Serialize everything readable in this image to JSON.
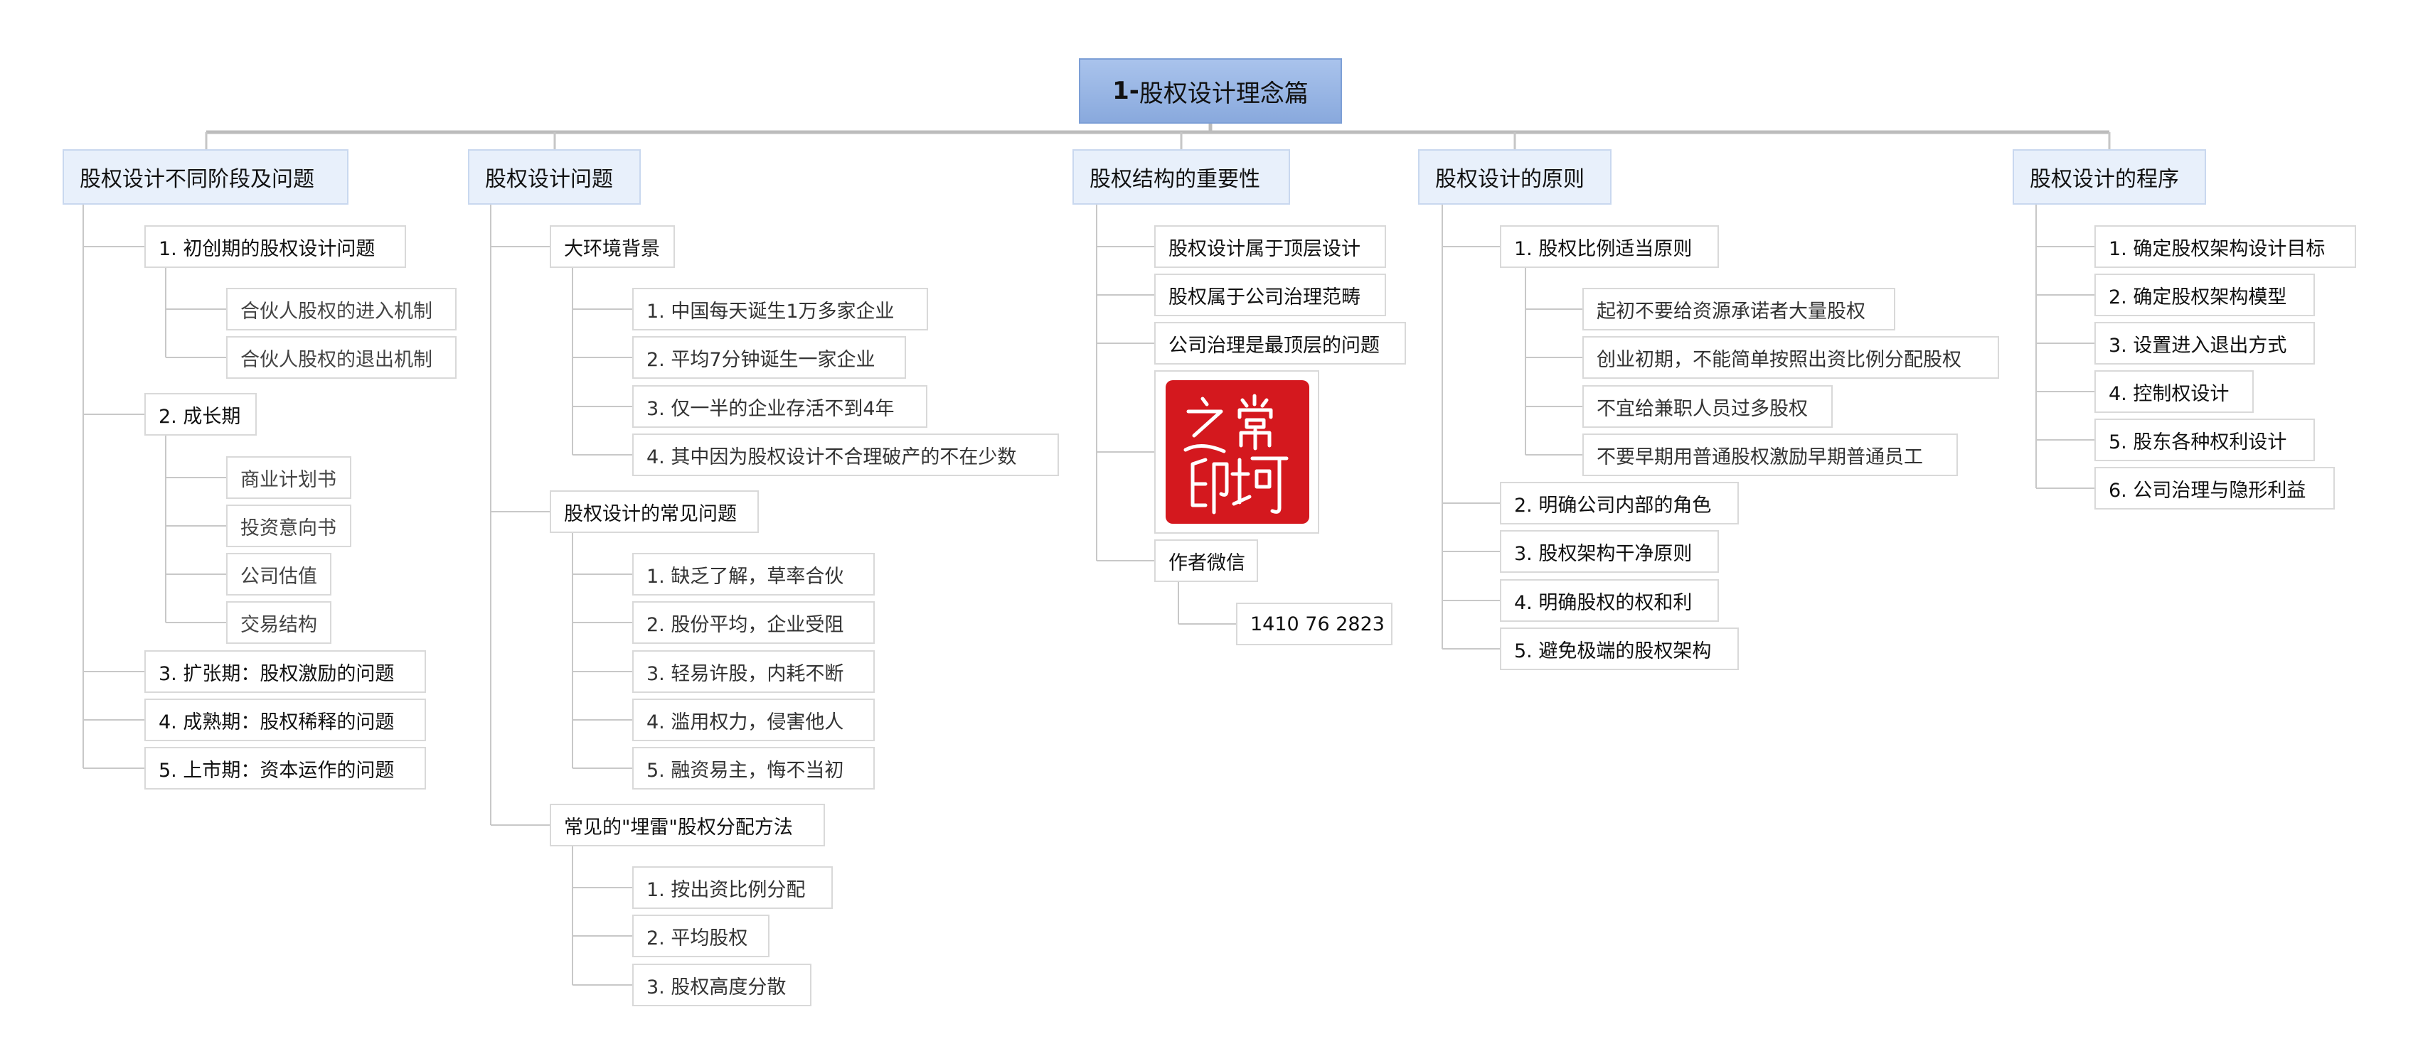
{
  "root": {
    "prefix": "1-",
    "title": "股权设计理念篇"
  },
  "branches": [
    {
      "title": "股权设计不同阶段及问题",
      "items": [
        {
          "label": "1. 初创期的股权设计问题",
          "children": [
            "合伙人股权的进入机制",
            "合伙人股权的退出机制"
          ]
        },
        {
          "label": "2. 成长期",
          "children": [
            "商业计划书",
            "投资意向书",
            "公司估值",
            "交易结构"
          ]
        },
        {
          "label": "3. 扩张期：股权激励的问题"
        },
        {
          "label": "4. 成熟期：股权稀释的问题"
        },
        {
          "label": "5. 上市期：资本运作的问题"
        }
      ]
    },
    {
      "title": "股权设计问题",
      "items": [
        {
          "label": "大环境背景",
          "children": [
            "1. 中国每天诞生1万多家企业",
            "2. 平均7分钟诞生一家企业",
            "3. 仅一半的企业存活不到4年",
            "4. 其中因为股权设计不合理破产的不在少数"
          ]
        },
        {
          "label": "股权设计的常见问题",
          "children": [
            "1. 缺乏了解，草率合伙",
            "2. 股份平均，企业受阻",
            "3. 轻易许股，内耗不断",
            "4. 滥用权力，侵害他人",
            "5. 融资易主，悔不当初"
          ]
        },
        {
          "label": "常见的\"埋雷\"股权分配方法",
          "children": [
            "1. 按出资比例分配",
            "2. 平均股权",
            "3. 股权高度分散"
          ]
        }
      ]
    },
    {
      "title": "股权结构的重要性",
      "items": [
        {
          "label": "股权设计属于顶层设计"
        },
        {
          "label": "股权属于公司治理范畴"
        },
        {
          "label": "公司治理是最顶层的问题"
        },
        {
          "label": "作者微信",
          "children": [
            "1410 76 2823"
          ]
        }
      ],
      "seal": {
        "text": "常坷之印",
        "color": "#d4181e"
      }
    },
    {
      "title": "股权设计的原则",
      "items": [
        {
          "label": "1. 股权比例适当原则",
          "children": [
            "起初不要给资源承诺者大量股权",
            "创业初期，不能简单按照出资比例分配股权",
            "不宜给兼职人员过多股权",
            "不要早期用普通股权激励早期普通员工"
          ]
        },
        {
          "label": "2. 明确公司内部的角色"
        },
        {
          "label": "3. 股权架构干净原则"
        },
        {
          "label": "4. 明确股权的权和利"
        },
        {
          "label": "5. 避免极端的股权架构"
        }
      ]
    },
    {
      "title": "股权设计的程序",
      "items": [
        {
          "label": "1. 确定股权架构设计目标"
        },
        {
          "label": "2. 确定股权架构模型"
        },
        {
          "label": "3. 设置进入退出方式"
        },
        {
          "label": "4. 控制权设计"
        },
        {
          "label": "5. 股东各种权利设计"
        },
        {
          "label": "6. 公司治理与隐形利益"
        }
      ]
    }
  ]
}
